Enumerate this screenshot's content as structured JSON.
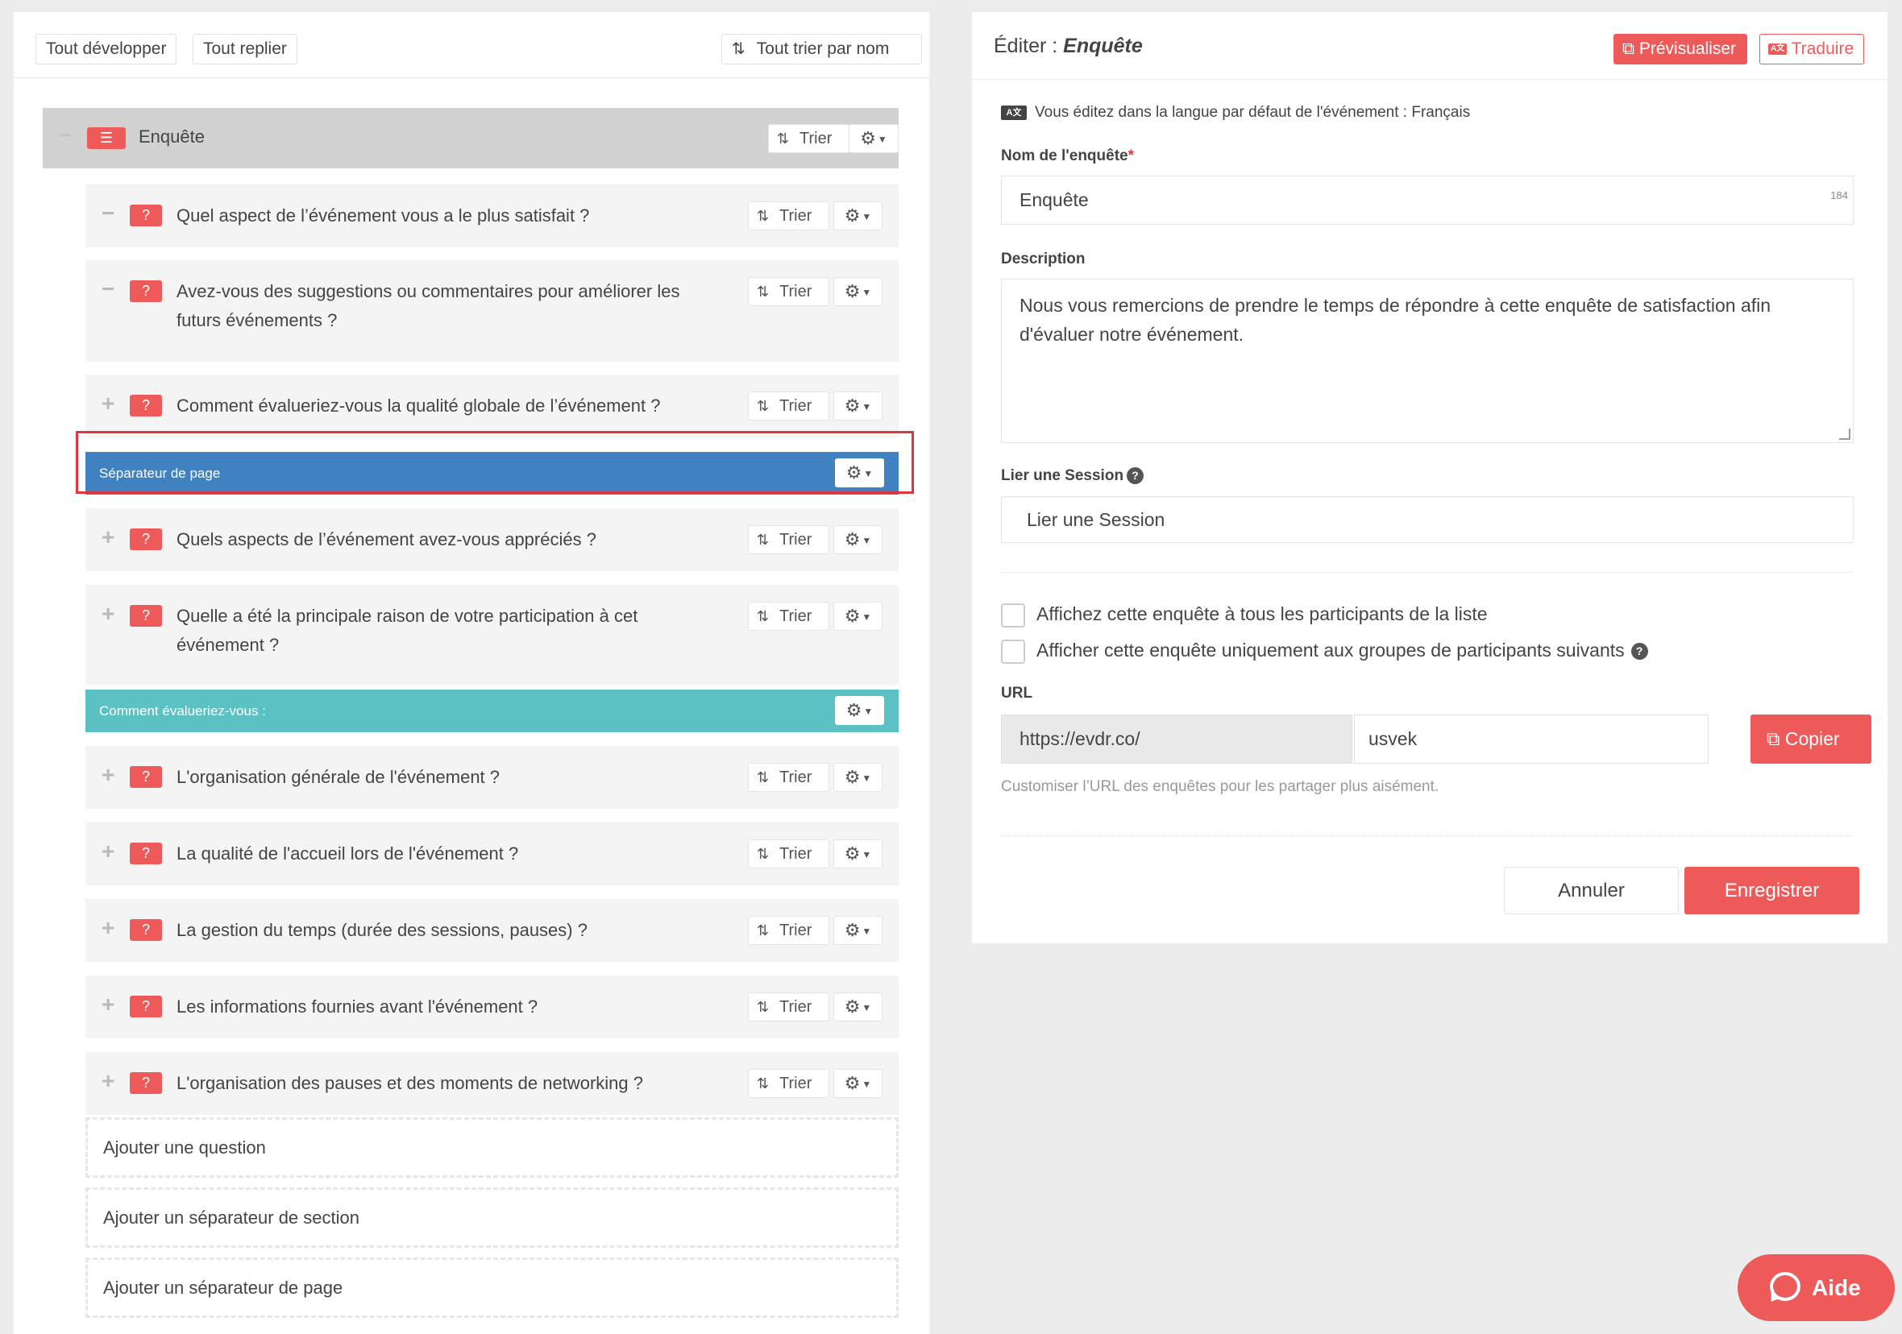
{
  "left_toolbar": {
    "expand_all": "Tout développer",
    "collapse_all": "Tout replier",
    "sort_all": "Tout trier par nom",
    "sort_icon": "sort-alpha-icon"
  },
  "tree": {
    "root": {
      "label": "Enquête",
      "sort_label": "Trier",
      "icon": "list-icon"
    },
    "sort_label": "Trier",
    "question_icon_text": "?",
    "items": [
      {
        "type": "question",
        "toggle": "−",
        "text": "Quel aspect de l’événement vous a le plus satisfait ?"
      },
      {
        "type": "question",
        "toggle": "−",
        "text": "Avez-vous des suggestions ou commentaires pour améliorer les futurs événements ?"
      },
      {
        "type": "question",
        "toggle": "+",
        "text": "Comment évalueriez-vous la qualité globale de l’événement ?"
      },
      {
        "type": "page-separator",
        "text": "Séparateur de page",
        "color": "#3f81c1"
      },
      {
        "type": "question",
        "toggle": "+",
        "text": "Quels aspects de l’événement avez-vous appréciés ?"
      },
      {
        "type": "question",
        "toggle": "+",
        "text": "Quelle a été la principale raison de votre participation à cet événement ?"
      },
      {
        "type": "section-separator",
        "text": "Comment évalueriez-vous :",
        "color": "#5bc1c3"
      },
      {
        "type": "question",
        "toggle": "+",
        "text": "L'organisation générale de l'événement ?"
      },
      {
        "type": "question",
        "toggle": "+",
        "text": "La qualité de l'accueil lors de l'événement ?"
      },
      {
        "type": "question",
        "toggle": "+",
        "text": "La gestion du temps (durée des sessions, pauses) ?"
      },
      {
        "type": "question",
        "toggle": "+",
        "text": "Les informations fournies avant l'événement ?"
      },
      {
        "type": "question",
        "toggle": "+",
        "text": "L'organisation des pauses et des moments de networking ?"
      }
    ],
    "add_actions": [
      "Ajouter une question",
      "Ajouter un séparateur de section",
      "Ajouter un séparateur de page"
    ]
  },
  "editor": {
    "title_prefix": "Éditer :",
    "title_entity": "Enquête",
    "preview_label": "Prévisualiser",
    "translate_label": "Traduire",
    "lang_note": "Vous éditez dans la langue par défaut de l'événement : Français",
    "name_label": "Nom de l'enquête",
    "name_required_mark": "*",
    "name_value": "Enquête",
    "name_counter": "184",
    "description_label": "Description",
    "description_value": "Nous vous remercions de prendre le temps de répondre à cette enquête de satisfaction afin d'évaluer notre événement.",
    "session_label": "Lier une Session",
    "session_placeholder": "Lier une Session",
    "check_all_label": "Affichez cette enquête à tous les participants de la liste",
    "check_groups_label": "Afficher cette enquête uniquement aux groupes de participants suivants",
    "url_label": "URL",
    "url_prefix": "https://evdr.co/",
    "url_slug": "usvek",
    "copy_label": "Copier",
    "url_help": "Customiser l’URL des enquêtes pour les partager plus aisément.",
    "cancel_label": "Annuler",
    "save_label": "Enregistrer"
  },
  "help_button": {
    "label": "Aide"
  },
  "colors": {
    "accent": "#ee5a5a",
    "page_separator": "#3f81c1",
    "section_separator": "#5bc1c3",
    "highlight": "#d9393e"
  }
}
